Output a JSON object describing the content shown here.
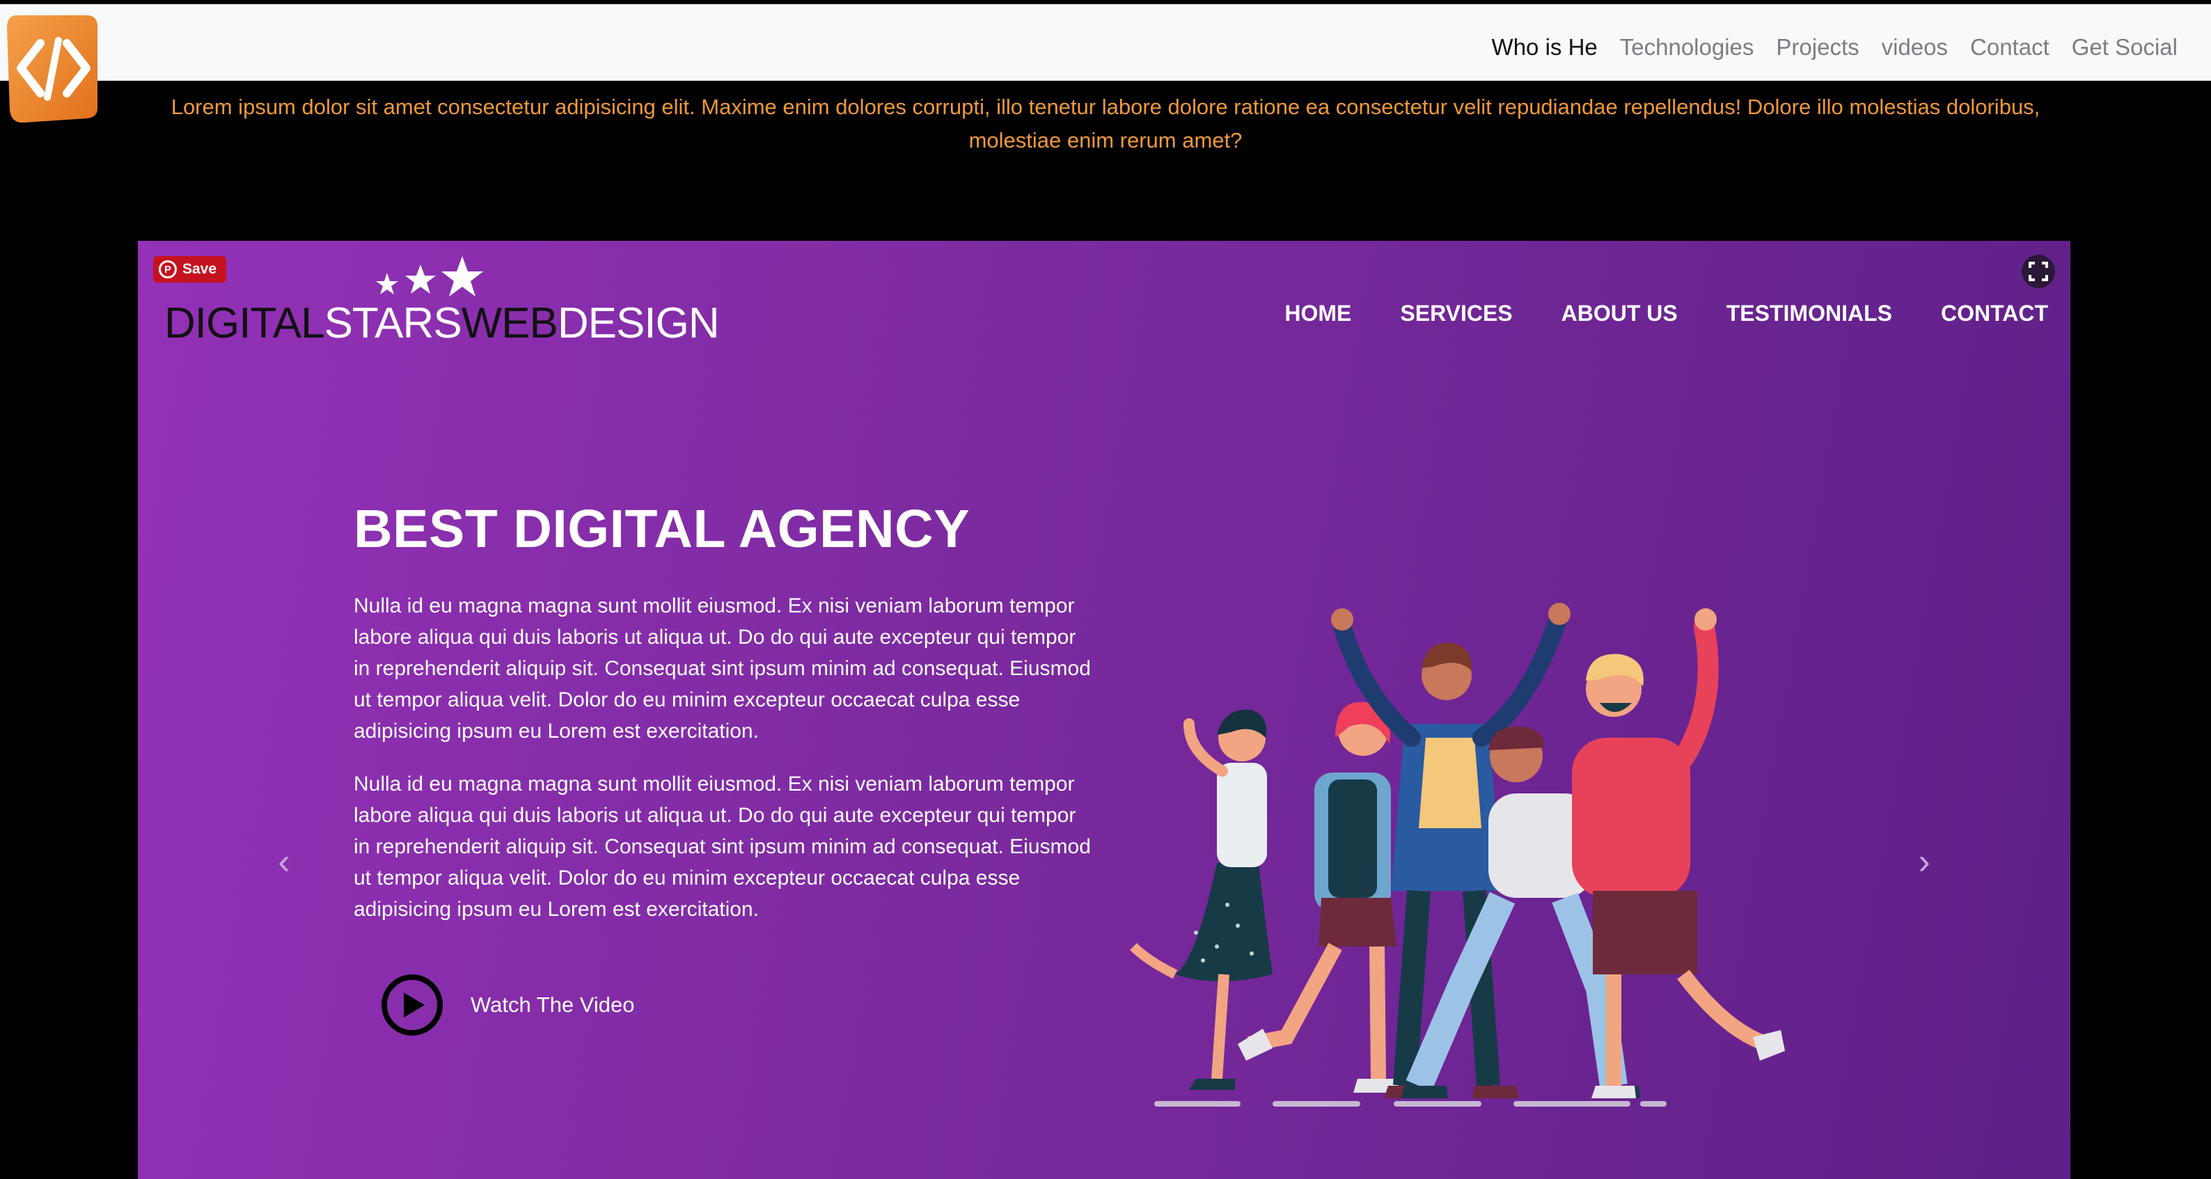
{
  "topnav": {
    "items": [
      {
        "label": "Who is He",
        "active": true
      },
      {
        "label": "Technologies",
        "active": false
      },
      {
        "label": "Projects",
        "active": false
      },
      {
        "label": "videos",
        "active": false
      },
      {
        "label": "Contact",
        "active": false
      },
      {
        "label": "Get Social",
        "active": false
      }
    ]
  },
  "intro_text": "Lorem ipsum dolor sit amet consectetur adipisicing elit. Maxime enim dolores corrupti, illo tenetur labore dolore ratione ea consectetur velit repudiandae repellendus! Dolore illo molestias doloribus, molestiae enim rerum amet?",
  "hero": {
    "pin_save_label": "Save",
    "brand": {
      "part1": "DIGITAL",
      "part2": "STARS",
      "part3": "WEB",
      "part4": "DESIGN"
    },
    "nav": [
      "HOME",
      "SERVICES",
      "ABOUT US",
      "TESTIMONIALS",
      "CONTACT"
    ],
    "headline": "BEST DIGITAL AGENCY",
    "paragraph1": "Nulla id eu magna magna sunt mollit eiusmod. Ex nisi veniam laborum tempor labore aliqua qui duis laboris ut aliqua ut. Do do qui aute excepteur qui tempor in reprehenderit aliquip sit. Consequat sint ipsum minim ad consequat. Eiusmod ut tempor aliqua velit. Dolor do eu minim excepteur occaecat culpa esse adipisicing ipsum eu Lorem est exercitation.",
    "paragraph2": "Nulla id eu magna magna sunt mollit eiusmod. Ex nisi veniam laborum tempor labore aliqua qui duis laboris ut aliqua ut. Do do qui aute excepteur qui tempor in reprehenderit aliquip sit. Consequat sint ipsum minim ad consequat. Eiusmod ut tempor aliqua velit. Dolor do eu minim excepteur occaecat culpa esse adipisicing ipsum eu Lorem est exercitation.",
    "watch_label": "Watch The Video",
    "arrow_left": "‹",
    "arrow_right": "›"
  },
  "colors": {
    "intro_text": "#f0993a",
    "hero_gradient_start": "#9331b7",
    "hero_gradient_end": "#5d2086",
    "logo_orange": "#ef8a2d",
    "pinterest_red": "#c5121f"
  },
  "icons": [
    "code-logo-icon",
    "pinterest-icon",
    "fullscreen-icon",
    "star-icon",
    "play-icon",
    "chevron-left-icon",
    "chevron-right-icon"
  ]
}
